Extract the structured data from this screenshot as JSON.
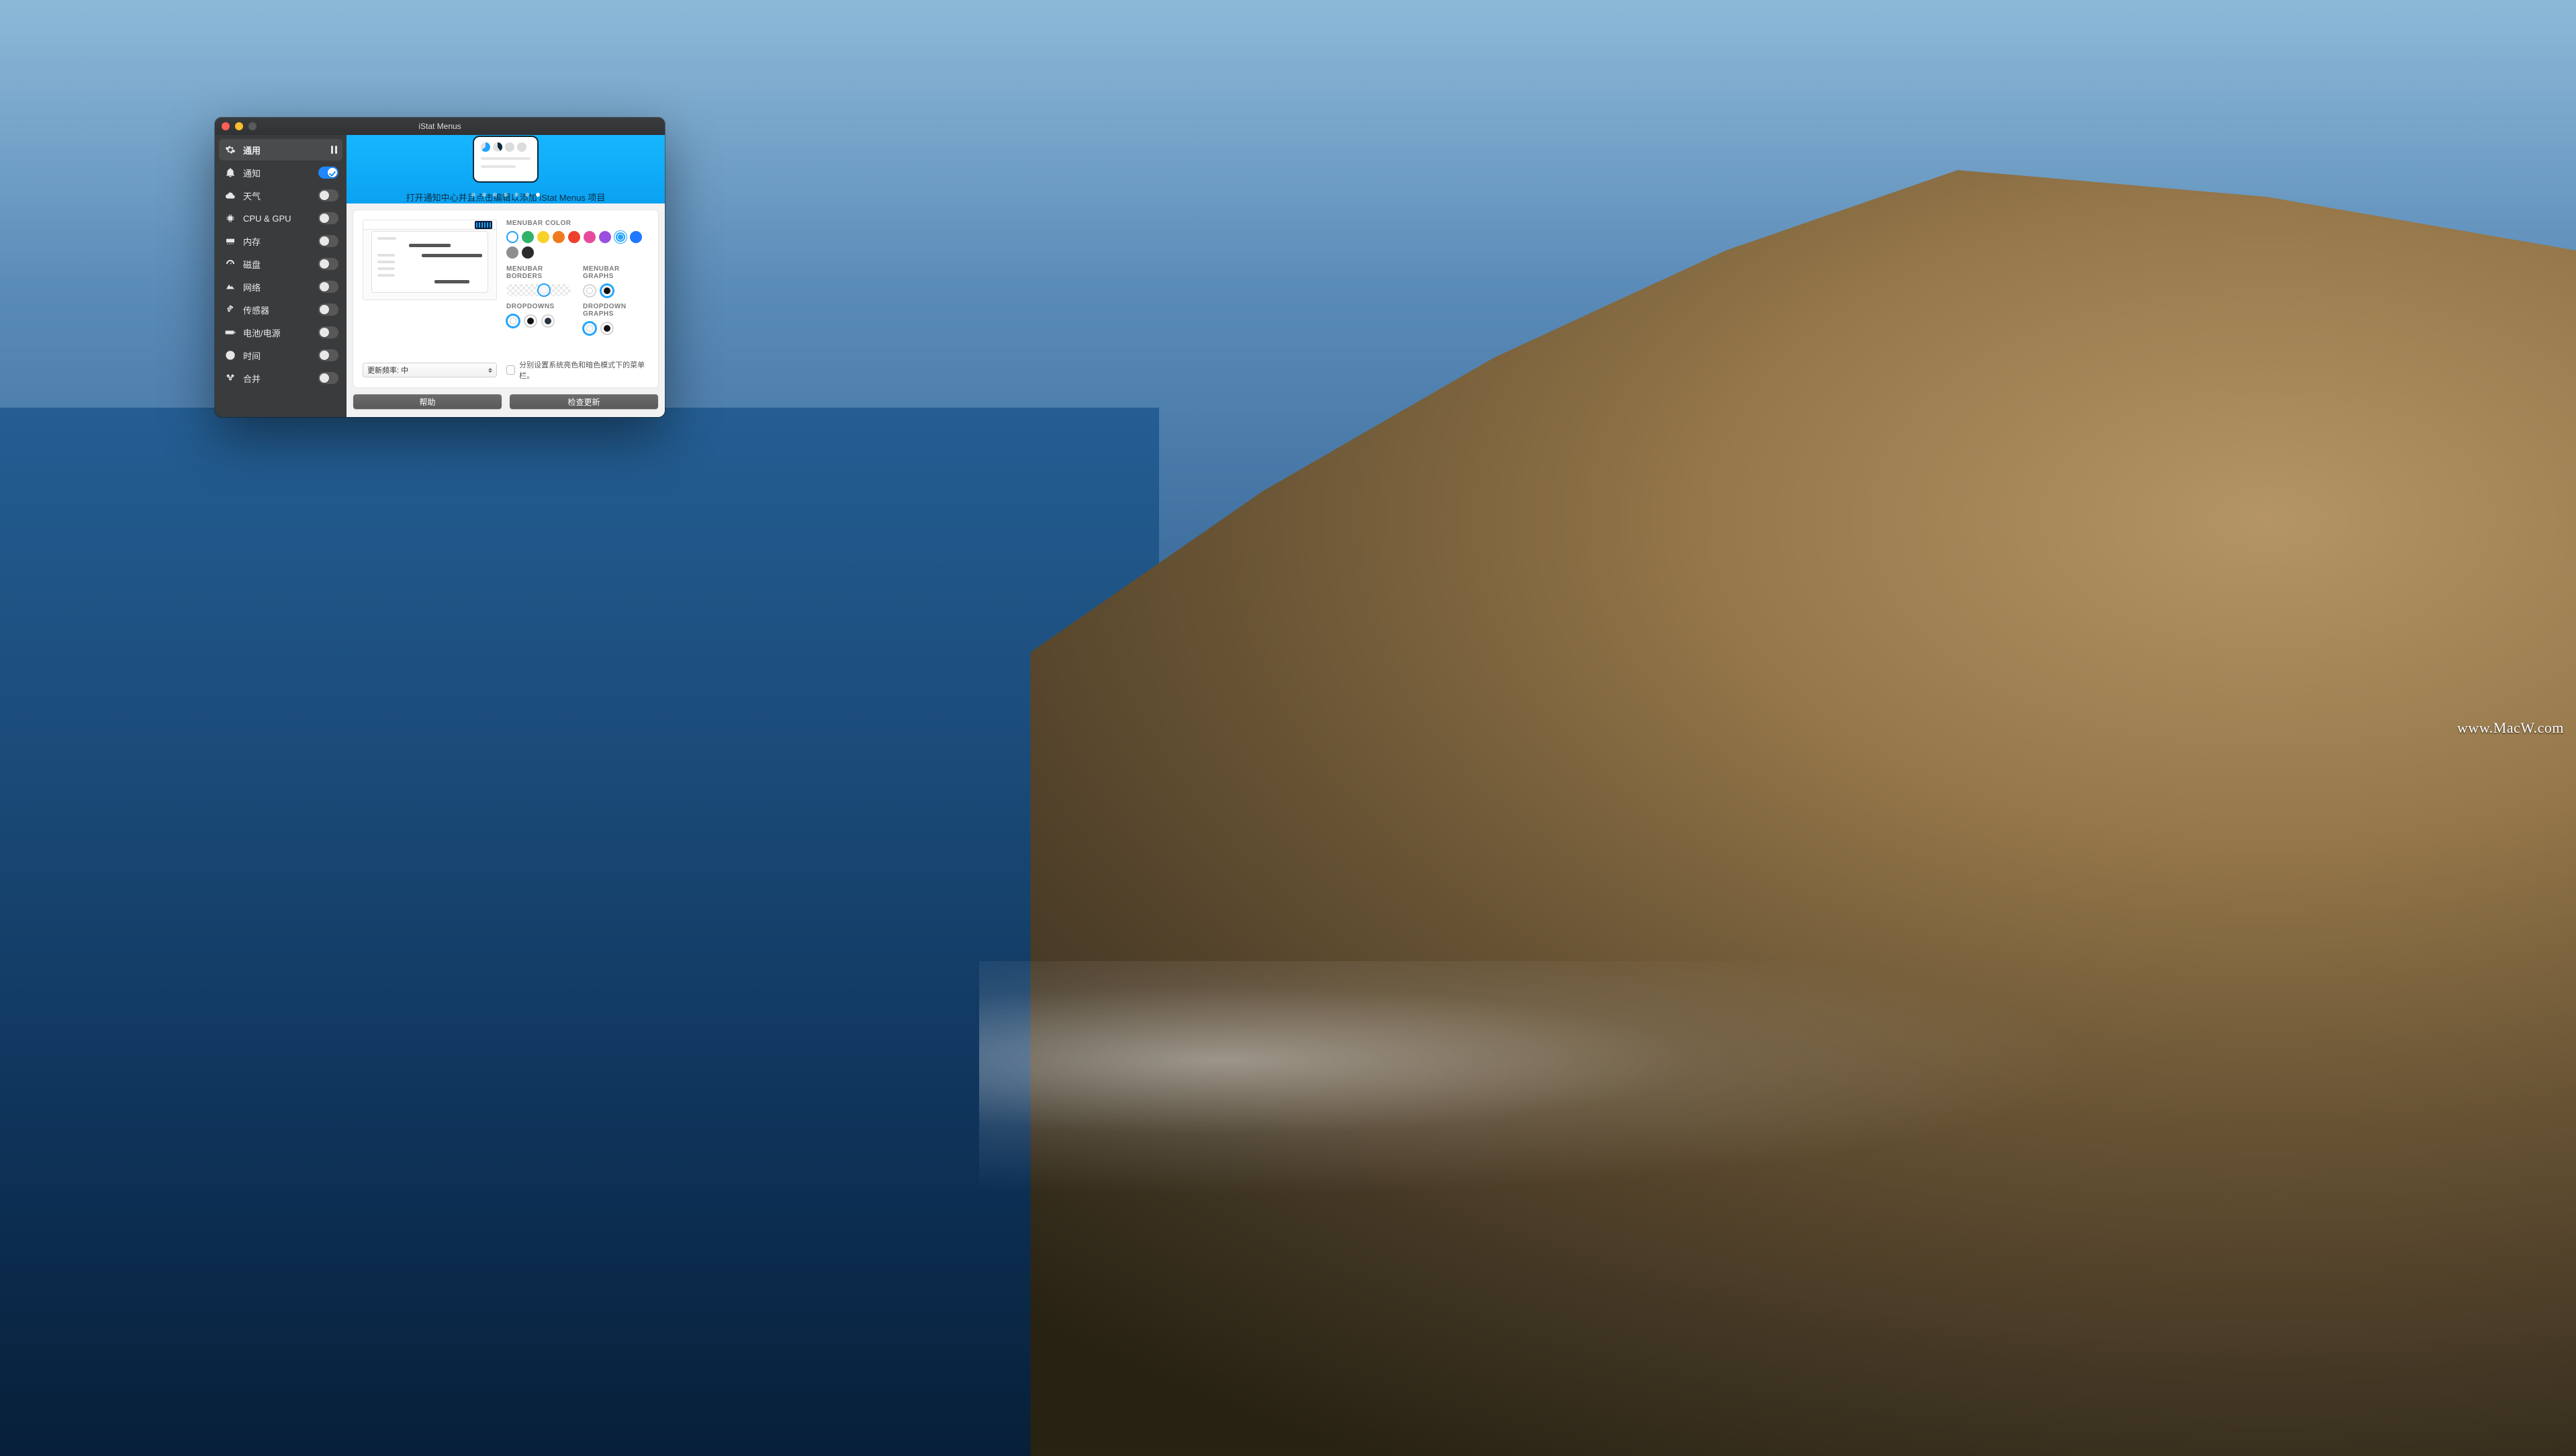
{
  "watermark": "www.MacW.com",
  "window": {
    "title": "iStat Menus"
  },
  "sidebar": {
    "items": [
      {
        "icon": "gear",
        "label": "通用",
        "active": true,
        "toggle": null
      },
      {
        "icon": "bell",
        "label": "通知",
        "active": false,
        "toggle": true
      },
      {
        "icon": "cloud",
        "label": "天气",
        "active": false,
        "toggle": false
      },
      {
        "icon": "chip",
        "label": "CPU & GPU",
        "active": false,
        "toggle": false
      },
      {
        "icon": "memory",
        "label": "内存",
        "active": false,
        "toggle": false
      },
      {
        "icon": "gauge",
        "label": "磁盘",
        "active": false,
        "toggle": false
      },
      {
        "icon": "network",
        "label": "网络",
        "active": false,
        "toggle": false
      },
      {
        "icon": "fan",
        "label": "传感器",
        "active": false,
        "toggle": false
      },
      {
        "icon": "battery",
        "label": "电池/电源",
        "active": false,
        "toggle": false
      },
      {
        "icon": "clock",
        "label": "时间",
        "active": false,
        "toggle": false
      },
      {
        "icon": "merge",
        "label": "合并",
        "active": false,
        "toggle": false
      }
    ]
  },
  "hero": {
    "caption": "打开通知中心并且点击编辑以添加 iStat Menus 项目",
    "page_count": 7,
    "page_index": 6
  },
  "config": {
    "menubar_color": {
      "label": "MENUBAR COLOR",
      "colors": [
        "#ffffff",
        "#2fb36a",
        "#f8d22a",
        "#f07b1f",
        "#ef3f2d",
        "#e64a9b",
        "#9b4fe0",
        "#1fa3ff",
        "#1f78ff",
        "#8e8e8e",
        "#2b2b2b"
      ],
      "selected_index": 7
    },
    "menubar_borders": {
      "label": "MENUBAR BORDERS"
    },
    "menubar_graphs": {
      "label": "MENUBAR GRAPHS",
      "options": [
        "#ffffff",
        "#111111"
      ],
      "selected_index": 1
    },
    "dropdowns": {
      "label": "DROPDOWNS",
      "options": [
        "#ffffff",
        "#111111",
        "#2b3440"
      ],
      "selected_index": 0
    },
    "dropdown_graphs": {
      "label": "DROPDOWN GRAPHS",
      "options": [
        "#ffffff",
        "#111111"
      ],
      "selected_index": 0
    },
    "update_freq": {
      "prefix": "更新频率: ",
      "value": "中"
    },
    "separate_appearance_label": "分别设置系统亮色和暗色模式下的菜单栏。"
  },
  "footer": {
    "help": "帮助",
    "check_updates": "检查更新"
  }
}
